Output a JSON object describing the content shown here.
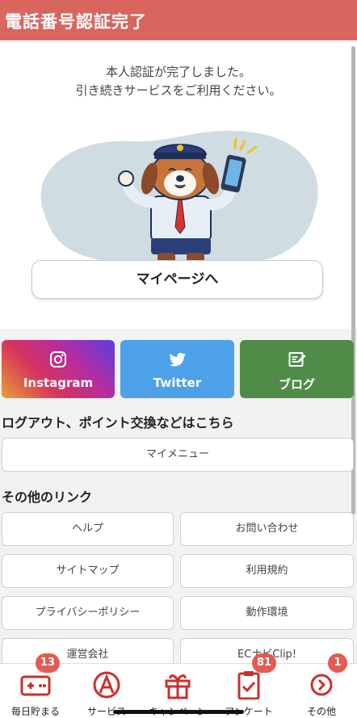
{
  "header": {
    "title": "電話番号認証完了"
  },
  "main": {
    "message_line1": "本人認証が完了しました。",
    "message_line2": "引き続きサービスをご利用ください。",
    "mypage_button": "マイページへ"
  },
  "social": [
    {
      "label": "Instagram",
      "icon": "instagram-icon",
      "color": "#c13584"
    },
    {
      "label": "Twitter",
      "icon": "twitter-icon",
      "color": "#4da1e8"
    },
    {
      "label": "ブログ",
      "icon": "blog-edit-icon",
      "color": "#4e8c47"
    }
  ],
  "logout_section": {
    "title": "ログアウト、ポイント交換などはこちら",
    "my_menu_button": "マイメニュー"
  },
  "links_section": {
    "title": "その他のリンク",
    "links": [
      "ヘルプ",
      "お問い合わせ",
      "サイトマップ",
      "利用規約",
      "プライバシーポリシー",
      "動作環境",
      "運営会社",
      "ECナビClip!"
    ]
  },
  "tabbar": {
    "accent_color": "#c9302c",
    "items": [
      {
        "label": "毎日貯まる",
        "icon": "gamepad-icon",
        "badge": "13"
      },
      {
        "label": "サービス",
        "icon": "service-a-icon",
        "badge": ""
      },
      {
        "label": "キャンペーン",
        "icon": "gift-icon",
        "badge": ""
      },
      {
        "label": "アンケート",
        "icon": "clipboard-check-icon",
        "badge": "81"
      },
      {
        "label": "その他",
        "icon": "chevron-circle-icon",
        "badge": "1"
      }
    ]
  }
}
